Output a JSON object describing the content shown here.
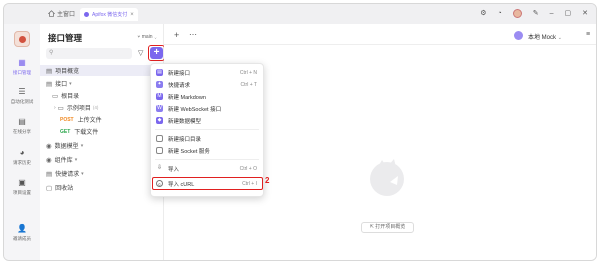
{
  "titlebar": {
    "home_tab": "主窗口",
    "active_tab": "Apifox 微信支付",
    "close": "×"
  },
  "rail": {
    "items": [
      {
        "label": "接口管理",
        "icon": "api-icon"
      },
      {
        "label": "自动化测试",
        "icon": "test-icon"
      },
      {
        "label": "在线分享",
        "icon": "share-icon"
      },
      {
        "label": "请求历史",
        "icon": "history-icon"
      },
      {
        "label": "项目设置",
        "icon": "settings-icon"
      },
      {
        "label": "邀请成员",
        "icon": "invite-icon"
      }
    ]
  },
  "sidebar": {
    "title": "接口管理",
    "branch": "main",
    "search_placeholder": "",
    "tree": [
      {
        "label": "项目概览",
        "icon": "▤"
      },
      {
        "label": "接口",
        "icon": "▤"
      },
      {
        "label": "根目录",
        "icon": "▭"
      },
      {
        "label": "示例项目",
        "icon": "▭",
        "count": "(4)"
      },
      {
        "method": "POST",
        "label": "上传文件"
      },
      {
        "method": "GET",
        "label": "下载文件"
      },
      {
        "label": "数据模型",
        "icon": "◉"
      },
      {
        "label": "组件库",
        "icon": "◉"
      },
      {
        "label": "快捷请求",
        "icon": "▤"
      },
      {
        "label": "回收站",
        "icon": "▢"
      }
    ]
  },
  "markers": {
    "one": "1",
    "two": "2"
  },
  "menu": {
    "items": [
      {
        "label": "新建接口",
        "shortcut": "Ctrl + N",
        "icon_color": "#7b67ee"
      },
      {
        "label": "快捷请求",
        "shortcut": "Ctrl + T",
        "icon_color": "#8a7cf0"
      },
      {
        "label": "新建 Markdown",
        "shortcut": "",
        "icon_color": "#7b67ee"
      },
      {
        "label": "新建 WebSocket 接口",
        "shortcut": "",
        "icon_color": "#8a7cf0"
      },
      {
        "label": "新建数据模型",
        "shortcut": "",
        "icon_color": "#7b67ee"
      },
      {
        "label": "新建接口目录",
        "shortcut": "",
        "icon_color": "#666666"
      },
      {
        "label": "新建 Socket 服务",
        "shortcut": "",
        "icon_color": "#666666"
      },
      {
        "label": "导入",
        "shortcut": "Ctrl + O",
        "icon_color": "#666666"
      },
      {
        "label": "导入 cURL",
        "shortcut": "Ctrl + I",
        "icon_color": "#666666"
      }
    ]
  },
  "main": {
    "env_label": "本地 Mock",
    "open_overview": "打开项目概览"
  },
  "colors": {
    "accent": "#7b67ee",
    "highlight": "#e02020"
  }
}
